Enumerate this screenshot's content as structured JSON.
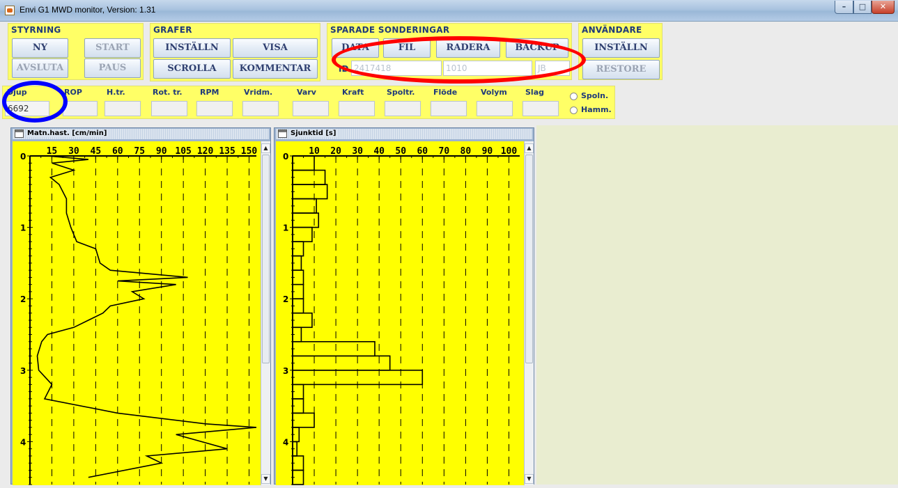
{
  "window": {
    "title": "Envi G1 MWD monitor,  Version: 1.31",
    "min_glyph": "–",
    "max_glyph": "□",
    "close_glyph": "✕"
  },
  "styrning": {
    "title": "STYRNING",
    "ny": "NY",
    "start": "START",
    "avsluta": "AVSLUTA",
    "paus": "PAUS"
  },
  "grafer": {
    "title": "GRAFER",
    "installn": "INSTÄLLN",
    "visa": "VISA",
    "scrolla": "SCROLLA",
    "kommentar": "KOMMENTAR"
  },
  "sparade": {
    "title": "SPARADE SONDERINGAR",
    "data": "DATA",
    "fil": "FIL",
    "radera": "RADERA",
    "backup": "BACKUP",
    "id_label": "ID",
    "field1": "2417418",
    "field2": "1010",
    "field3": "JB"
  },
  "anvandare": {
    "title": "ANVÄNDARE",
    "installn": "INSTÄLLN",
    "restore": "RESTORE"
  },
  "measurements": {
    "djup_label": "Djup",
    "djup_value": "6692",
    "rop": "ROP",
    "htr": "H.tr.",
    "rottr": "Rot. tr.",
    "rpm": "RPM",
    "vridm": "Vridm.",
    "varv": "Varv",
    "kraft": "Kraft",
    "spoltr": "Spoltr.",
    "flode": "Flöde",
    "volym": "Volym",
    "slag": "Slag",
    "spoln": "Spoln.",
    "hamm": "Hamm."
  },
  "chart_data": [
    {
      "type": "line",
      "title": "Matn.hast. [cm/min]",
      "x_ticks": [
        15,
        30,
        45,
        60,
        75,
        90,
        105,
        120,
        135,
        150
      ],
      "xlim": [
        0,
        155
      ],
      "y_ticks": [
        0,
        1,
        2,
        3,
        4
      ],
      "ylim": [
        0,
        4.6
      ],
      "grid": true,
      "approx_profile": [
        {
          "depth": 0.0,
          "value": 12
        },
        {
          "depth": 0.05,
          "value": 40
        },
        {
          "depth": 0.1,
          "value": 15
        },
        {
          "depth": 0.2,
          "value": 30
        },
        {
          "depth": 0.3,
          "value": 14
        },
        {
          "depth": 0.4,
          "value": 20
        },
        {
          "depth": 0.6,
          "value": 25
        },
        {
          "depth": 0.8,
          "value": 25
        },
        {
          "depth": 1.0,
          "value": 28
        },
        {
          "depth": 1.1,
          "value": 30
        },
        {
          "depth": 1.2,
          "value": 32
        },
        {
          "depth": 1.3,
          "value": 45
        },
        {
          "depth": 1.5,
          "value": 48
        },
        {
          "depth": 1.6,
          "value": 55
        },
        {
          "depth": 1.7,
          "value": 108
        },
        {
          "depth": 1.75,
          "value": 60
        },
        {
          "depth": 1.8,
          "value": 100
        },
        {
          "depth": 1.9,
          "value": 70
        },
        {
          "depth": 2.0,
          "value": 78
        },
        {
          "depth": 2.1,
          "value": 55
        },
        {
          "depth": 2.2,
          "value": 50
        },
        {
          "depth": 2.4,
          "value": 30
        },
        {
          "depth": 2.5,
          "value": 12
        },
        {
          "depth": 2.6,
          "value": 8
        },
        {
          "depth": 2.8,
          "value": 5
        },
        {
          "depth": 3.0,
          "value": 6
        },
        {
          "depth": 3.2,
          "value": 15
        },
        {
          "depth": 3.4,
          "value": 10
        },
        {
          "depth": 3.6,
          "value": 60
        },
        {
          "depth": 3.75,
          "value": 120
        },
        {
          "depth": 3.8,
          "value": 155
        },
        {
          "depth": 3.9,
          "value": 100
        },
        {
          "depth": 4.1,
          "value": 135
        },
        {
          "depth": 4.2,
          "value": 80
        },
        {
          "depth": 4.3,
          "value": 90
        },
        {
          "depth": 4.5,
          "value": 40
        }
      ]
    },
    {
      "type": "bar",
      "orientation": "horizontal",
      "title": "Sjunktid [s]",
      "x_ticks": [
        10,
        20,
        30,
        40,
        50,
        60,
        70,
        80,
        90,
        100
      ],
      "xlim": [
        0,
        105
      ],
      "y_ticks": [
        0,
        1,
        2,
        3,
        4
      ],
      "ylim": [
        0,
        4.6
      ],
      "grid": true,
      "bin_size": 0.2,
      "values": [
        10,
        15,
        16,
        11,
        12,
        9,
        5,
        4,
        5,
        5,
        5,
        9,
        4,
        38,
        45,
        60,
        5,
        5,
        10,
        3,
        2,
        5,
        5
      ]
    }
  ]
}
